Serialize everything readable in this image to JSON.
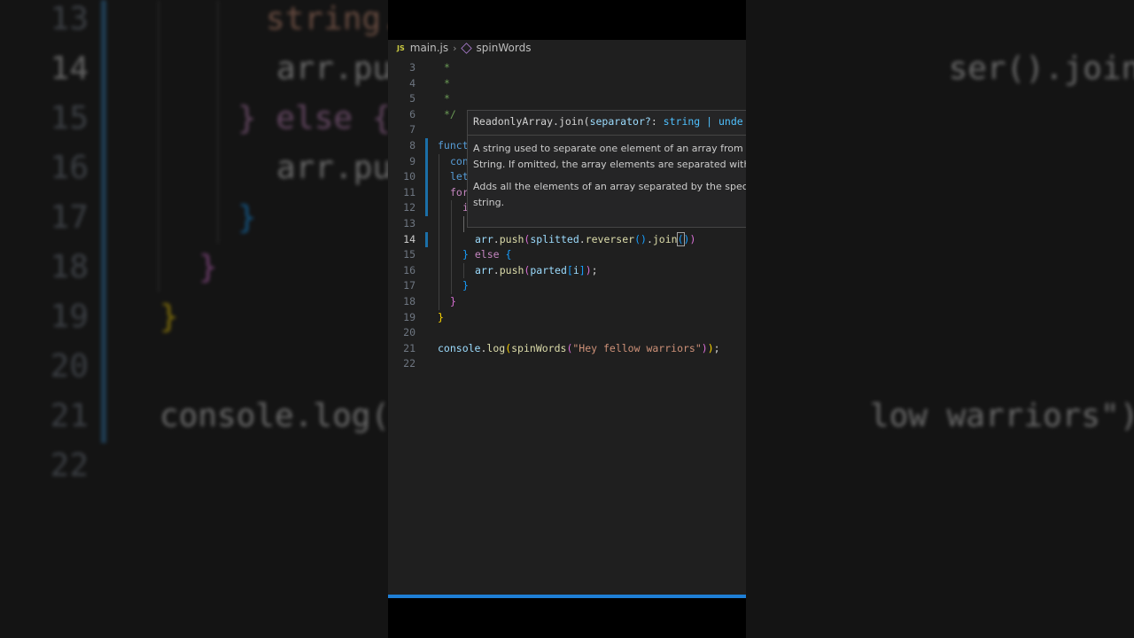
{
  "background": {
    "lines": [
      {
        "num": "13",
        "text": "string.",
        "cls": "c-str"
      },
      {
        "num": "14",
        "text": "arr.pu                             ser().join())"
      },
      {
        "num": "15",
        "text": "} else {"
      },
      {
        "num": "16",
        "text": "arr.pu"
      },
      {
        "num": "17",
        "text": "}"
      },
      {
        "num": "18",
        "text": "}"
      },
      {
        "num": "19",
        "text": "}"
      },
      {
        "num": "20",
        "text": ""
      },
      {
        "num": "21",
        "text": "console.log(                         low warriors\"));"
      },
      {
        "num": "22",
        "text": ""
      }
    ]
  },
  "editor": {
    "breadcrumb": {
      "badge": "JS",
      "file": "main.js",
      "symbol": "spinWords"
    },
    "lines": [
      {
        "num": "3"
      },
      {
        "num": "4"
      },
      {
        "num": "5"
      },
      {
        "num": "6"
      },
      {
        "num": "7"
      },
      {
        "num": "8"
      },
      {
        "num": "9"
      },
      {
        "num": "10"
      },
      {
        "num": "11"
      },
      {
        "num": "12"
      },
      {
        "num": "13"
      },
      {
        "num": "14"
      },
      {
        "num": "15"
      },
      {
        "num": "16"
      },
      {
        "num": "17"
      },
      {
        "num": "18"
      },
      {
        "num": "19"
      },
      {
        "num": "20"
      },
      {
        "num": "21"
      },
      {
        "num": "22"
      }
    ],
    "current_line": "14"
  },
  "hover": {
    "signature_name": "ReadonlyArray.join(",
    "signature_param": "separator?",
    "signature_colon": ": ",
    "signature_type": "string | unde",
    "doc_1": "A string used to separate one element of an array from the resulting String. If omitted, the array elements are separated with a comma.",
    "doc_2": "Adds all the elements of an array separated by the specified separator string."
  }
}
